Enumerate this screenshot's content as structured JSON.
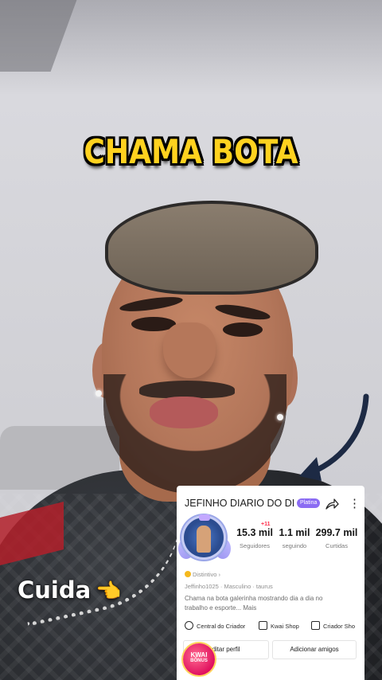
{
  "overlay": {
    "title": "CHAMA BOTA",
    "caption": "Cuida",
    "caption_emoji": "👈"
  },
  "profile_card": {
    "name": "JEFINHO DIARIO DO DI",
    "badge": "Platina",
    "share_icon": "share-arrow-icon",
    "more_icon": "more-vertical-icon",
    "new_followers": "+11",
    "stats": [
      {
        "value": "15.3 mil",
        "label": "Seguidores"
      },
      {
        "value": "1.1 mil",
        "label": "seguindo"
      },
      {
        "value": "299.7 mil",
        "label": "Curtidas"
      }
    ],
    "distintivo": "Distintivo",
    "meta": "Jeffinho1025  ·  Masculino  ·  taurus",
    "bio": "Chama na bota galerinha mostrando dia a dia no trabalho e esporte... Mais",
    "links": [
      {
        "label": "Central do Criador",
        "icon": "creator-icon"
      },
      {
        "label": "Kwai Shop",
        "icon": "shopping-bag-icon"
      },
      {
        "label": "Criador Sho",
        "icon": "store-icon"
      }
    ],
    "buttons": {
      "edit": "ditar perfil",
      "add_friends": "Adicionar amigos"
    }
  },
  "kwai_bonus": {
    "line1": "KWAI",
    "line2": "BÔNUS"
  },
  "colors": {
    "title_yellow": "#ffd21f",
    "arrow_navy": "#1d2a44",
    "badge_purple": "#8b6cf3",
    "new_red": "#ff2f4c"
  }
}
